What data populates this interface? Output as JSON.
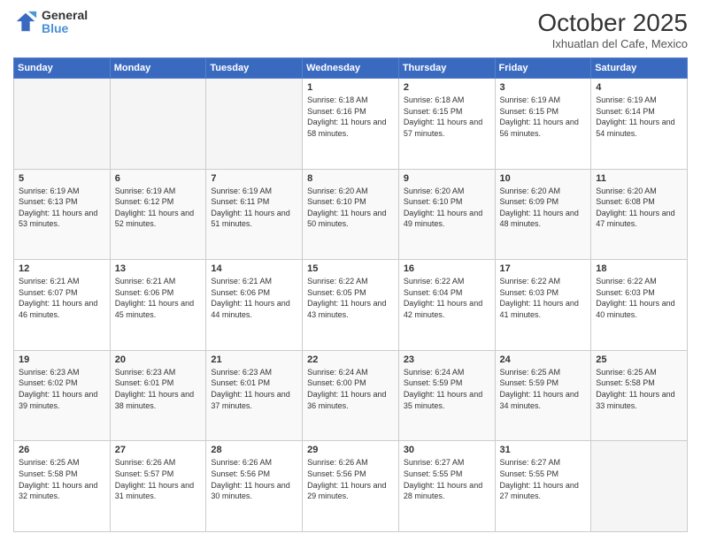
{
  "header": {
    "logo_line1": "General",
    "logo_line2": "Blue",
    "title": "October 2025",
    "subtitle": "Ixhuatlan del Cafe, Mexico"
  },
  "weekdays": [
    "Sunday",
    "Monday",
    "Tuesday",
    "Wednesday",
    "Thursday",
    "Friday",
    "Saturday"
  ],
  "weeks": [
    [
      {
        "day": "",
        "sunrise": "",
        "sunset": "",
        "daylight": ""
      },
      {
        "day": "",
        "sunrise": "",
        "sunset": "",
        "daylight": ""
      },
      {
        "day": "",
        "sunrise": "",
        "sunset": "",
        "daylight": ""
      },
      {
        "day": "1",
        "sunrise": "Sunrise: 6:18 AM",
        "sunset": "Sunset: 6:16 PM",
        "daylight": "Daylight: 11 hours and 58 minutes."
      },
      {
        "day": "2",
        "sunrise": "Sunrise: 6:18 AM",
        "sunset": "Sunset: 6:15 PM",
        "daylight": "Daylight: 11 hours and 57 minutes."
      },
      {
        "day": "3",
        "sunrise": "Sunrise: 6:19 AM",
        "sunset": "Sunset: 6:15 PM",
        "daylight": "Daylight: 11 hours and 56 minutes."
      },
      {
        "day": "4",
        "sunrise": "Sunrise: 6:19 AM",
        "sunset": "Sunset: 6:14 PM",
        "daylight": "Daylight: 11 hours and 54 minutes."
      }
    ],
    [
      {
        "day": "5",
        "sunrise": "Sunrise: 6:19 AM",
        "sunset": "Sunset: 6:13 PM",
        "daylight": "Daylight: 11 hours and 53 minutes."
      },
      {
        "day": "6",
        "sunrise": "Sunrise: 6:19 AM",
        "sunset": "Sunset: 6:12 PM",
        "daylight": "Daylight: 11 hours and 52 minutes."
      },
      {
        "day": "7",
        "sunrise": "Sunrise: 6:19 AM",
        "sunset": "Sunset: 6:11 PM",
        "daylight": "Daylight: 11 hours and 51 minutes."
      },
      {
        "day": "8",
        "sunrise": "Sunrise: 6:20 AM",
        "sunset": "Sunset: 6:10 PM",
        "daylight": "Daylight: 11 hours and 50 minutes."
      },
      {
        "day": "9",
        "sunrise": "Sunrise: 6:20 AM",
        "sunset": "Sunset: 6:10 PM",
        "daylight": "Daylight: 11 hours and 49 minutes."
      },
      {
        "day": "10",
        "sunrise": "Sunrise: 6:20 AM",
        "sunset": "Sunset: 6:09 PM",
        "daylight": "Daylight: 11 hours and 48 minutes."
      },
      {
        "day": "11",
        "sunrise": "Sunrise: 6:20 AM",
        "sunset": "Sunset: 6:08 PM",
        "daylight": "Daylight: 11 hours and 47 minutes."
      }
    ],
    [
      {
        "day": "12",
        "sunrise": "Sunrise: 6:21 AM",
        "sunset": "Sunset: 6:07 PM",
        "daylight": "Daylight: 11 hours and 46 minutes."
      },
      {
        "day": "13",
        "sunrise": "Sunrise: 6:21 AM",
        "sunset": "Sunset: 6:06 PM",
        "daylight": "Daylight: 11 hours and 45 minutes."
      },
      {
        "day": "14",
        "sunrise": "Sunrise: 6:21 AM",
        "sunset": "Sunset: 6:06 PM",
        "daylight": "Daylight: 11 hours and 44 minutes."
      },
      {
        "day": "15",
        "sunrise": "Sunrise: 6:22 AM",
        "sunset": "Sunset: 6:05 PM",
        "daylight": "Daylight: 11 hours and 43 minutes."
      },
      {
        "day": "16",
        "sunrise": "Sunrise: 6:22 AM",
        "sunset": "Sunset: 6:04 PM",
        "daylight": "Daylight: 11 hours and 42 minutes."
      },
      {
        "day": "17",
        "sunrise": "Sunrise: 6:22 AM",
        "sunset": "Sunset: 6:03 PM",
        "daylight": "Daylight: 11 hours and 41 minutes."
      },
      {
        "day": "18",
        "sunrise": "Sunrise: 6:22 AM",
        "sunset": "Sunset: 6:03 PM",
        "daylight": "Daylight: 11 hours and 40 minutes."
      }
    ],
    [
      {
        "day": "19",
        "sunrise": "Sunrise: 6:23 AM",
        "sunset": "Sunset: 6:02 PM",
        "daylight": "Daylight: 11 hours and 39 minutes."
      },
      {
        "day": "20",
        "sunrise": "Sunrise: 6:23 AM",
        "sunset": "Sunset: 6:01 PM",
        "daylight": "Daylight: 11 hours and 38 minutes."
      },
      {
        "day": "21",
        "sunrise": "Sunrise: 6:23 AM",
        "sunset": "Sunset: 6:01 PM",
        "daylight": "Daylight: 11 hours and 37 minutes."
      },
      {
        "day": "22",
        "sunrise": "Sunrise: 6:24 AM",
        "sunset": "Sunset: 6:00 PM",
        "daylight": "Daylight: 11 hours and 36 minutes."
      },
      {
        "day": "23",
        "sunrise": "Sunrise: 6:24 AM",
        "sunset": "Sunset: 5:59 PM",
        "daylight": "Daylight: 11 hours and 35 minutes."
      },
      {
        "day": "24",
        "sunrise": "Sunrise: 6:25 AM",
        "sunset": "Sunset: 5:59 PM",
        "daylight": "Daylight: 11 hours and 34 minutes."
      },
      {
        "day": "25",
        "sunrise": "Sunrise: 6:25 AM",
        "sunset": "Sunset: 5:58 PM",
        "daylight": "Daylight: 11 hours and 33 minutes."
      }
    ],
    [
      {
        "day": "26",
        "sunrise": "Sunrise: 6:25 AM",
        "sunset": "Sunset: 5:58 PM",
        "daylight": "Daylight: 11 hours and 32 minutes."
      },
      {
        "day": "27",
        "sunrise": "Sunrise: 6:26 AM",
        "sunset": "Sunset: 5:57 PM",
        "daylight": "Daylight: 11 hours and 31 minutes."
      },
      {
        "day": "28",
        "sunrise": "Sunrise: 6:26 AM",
        "sunset": "Sunset: 5:56 PM",
        "daylight": "Daylight: 11 hours and 30 minutes."
      },
      {
        "day": "29",
        "sunrise": "Sunrise: 6:26 AM",
        "sunset": "Sunset: 5:56 PM",
        "daylight": "Daylight: 11 hours and 29 minutes."
      },
      {
        "day": "30",
        "sunrise": "Sunrise: 6:27 AM",
        "sunset": "Sunset: 5:55 PM",
        "daylight": "Daylight: 11 hours and 28 minutes."
      },
      {
        "day": "31",
        "sunrise": "Sunrise: 6:27 AM",
        "sunset": "Sunset: 5:55 PM",
        "daylight": "Daylight: 11 hours and 27 minutes."
      },
      {
        "day": "",
        "sunrise": "",
        "sunset": "",
        "daylight": ""
      }
    ]
  ]
}
